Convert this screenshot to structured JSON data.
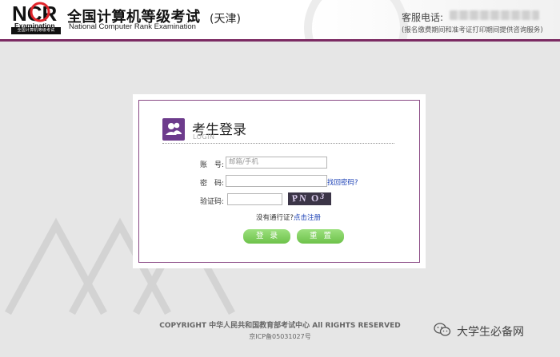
{
  "header": {
    "logo_text": "NCR",
    "logo_sub": "Examination",
    "logo_box": "全国计算机等级考试",
    "title_cn": "全国计算机等级考试",
    "title_en": "National Computer Rank Examination",
    "region": "(天津)",
    "phone_label": "客服电话:",
    "phone_note": "(报名缴费期间和准考证打印期间提供咨询服务)"
  },
  "login": {
    "title": "考生登录",
    "subtitle": "LOGIN",
    "account_label": "账　号:",
    "account_placeholder": "邮箱/手机",
    "password_label": "密　码:",
    "forgot_link": "找回密码?",
    "captcha_label": "验证码:",
    "captcha_text": [
      "P",
      "N",
      "O",
      "3"
    ],
    "no_pass_text": "没有通行证?",
    "register_link": "点击注册",
    "login_button": "登录",
    "reset_button": "重置"
  },
  "footer": {
    "copyright": "COPYRIGHT 中华人民共和国教育部考试中心 All RIGHTS RESERVED",
    "icp": "京ICP备05031027号"
  },
  "watermark": {
    "text": "大学生必备网"
  },
  "colors": {
    "brand_purple": "#7b2a62",
    "icon_purple": "#6d3b8c",
    "button_green": "#6dc24a",
    "link_blue": "#1a3fb5"
  }
}
